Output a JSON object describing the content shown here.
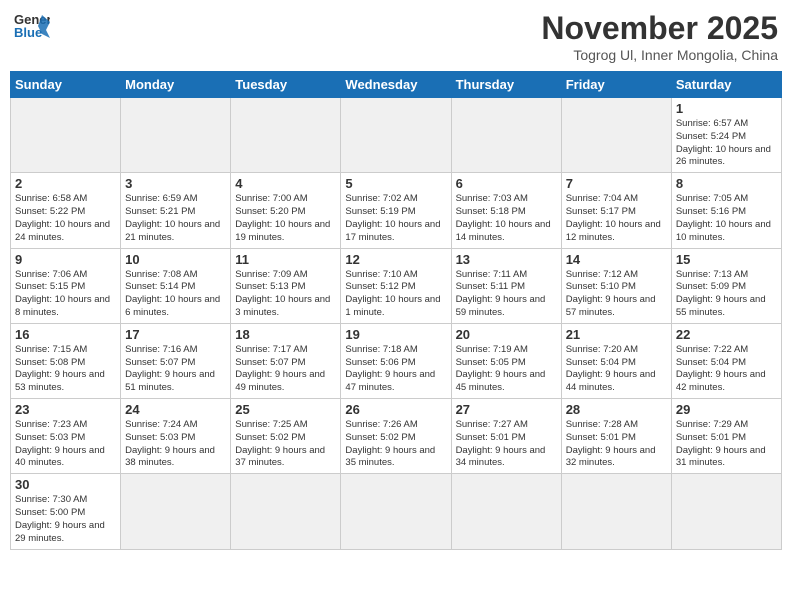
{
  "logo": {
    "text_general": "General",
    "text_blue": "Blue"
  },
  "title": "November 2025",
  "subtitle": "Togrog Ul, Inner Mongolia, China",
  "days_of_week": [
    "Sunday",
    "Monday",
    "Tuesday",
    "Wednesday",
    "Thursday",
    "Friday",
    "Saturday"
  ],
  "weeks": [
    [
      {
        "day": "",
        "info": "",
        "empty": true
      },
      {
        "day": "",
        "info": "",
        "empty": true
      },
      {
        "day": "",
        "info": "",
        "empty": true
      },
      {
        "day": "",
        "info": "",
        "empty": true
      },
      {
        "day": "",
        "info": "",
        "empty": true
      },
      {
        "day": "",
        "info": "",
        "empty": true
      },
      {
        "day": "1",
        "info": "Sunrise: 6:57 AM\nSunset: 5:24 PM\nDaylight: 10 hours and 26 minutes."
      }
    ],
    [
      {
        "day": "2",
        "info": "Sunrise: 6:58 AM\nSunset: 5:22 PM\nDaylight: 10 hours and 24 minutes."
      },
      {
        "day": "3",
        "info": "Sunrise: 6:59 AM\nSunset: 5:21 PM\nDaylight: 10 hours and 21 minutes."
      },
      {
        "day": "4",
        "info": "Sunrise: 7:00 AM\nSunset: 5:20 PM\nDaylight: 10 hours and 19 minutes."
      },
      {
        "day": "5",
        "info": "Sunrise: 7:02 AM\nSunset: 5:19 PM\nDaylight: 10 hours and 17 minutes."
      },
      {
        "day": "6",
        "info": "Sunrise: 7:03 AM\nSunset: 5:18 PM\nDaylight: 10 hours and 14 minutes."
      },
      {
        "day": "7",
        "info": "Sunrise: 7:04 AM\nSunset: 5:17 PM\nDaylight: 10 hours and 12 minutes."
      },
      {
        "day": "8",
        "info": "Sunrise: 7:05 AM\nSunset: 5:16 PM\nDaylight: 10 hours and 10 minutes."
      }
    ],
    [
      {
        "day": "9",
        "info": "Sunrise: 7:06 AM\nSunset: 5:15 PM\nDaylight: 10 hours and 8 minutes."
      },
      {
        "day": "10",
        "info": "Sunrise: 7:08 AM\nSunset: 5:14 PM\nDaylight: 10 hours and 6 minutes."
      },
      {
        "day": "11",
        "info": "Sunrise: 7:09 AM\nSunset: 5:13 PM\nDaylight: 10 hours and 3 minutes."
      },
      {
        "day": "12",
        "info": "Sunrise: 7:10 AM\nSunset: 5:12 PM\nDaylight: 10 hours and 1 minute."
      },
      {
        "day": "13",
        "info": "Sunrise: 7:11 AM\nSunset: 5:11 PM\nDaylight: 9 hours and 59 minutes."
      },
      {
        "day": "14",
        "info": "Sunrise: 7:12 AM\nSunset: 5:10 PM\nDaylight: 9 hours and 57 minutes."
      },
      {
        "day": "15",
        "info": "Sunrise: 7:13 AM\nSunset: 5:09 PM\nDaylight: 9 hours and 55 minutes."
      }
    ],
    [
      {
        "day": "16",
        "info": "Sunrise: 7:15 AM\nSunset: 5:08 PM\nDaylight: 9 hours and 53 minutes."
      },
      {
        "day": "17",
        "info": "Sunrise: 7:16 AM\nSunset: 5:07 PM\nDaylight: 9 hours and 51 minutes."
      },
      {
        "day": "18",
        "info": "Sunrise: 7:17 AM\nSunset: 5:07 PM\nDaylight: 9 hours and 49 minutes."
      },
      {
        "day": "19",
        "info": "Sunrise: 7:18 AM\nSunset: 5:06 PM\nDaylight: 9 hours and 47 minutes."
      },
      {
        "day": "20",
        "info": "Sunrise: 7:19 AM\nSunset: 5:05 PM\nDaylight: 9 hours and 45 minutes."
      },
      {
        "day": "21",
        "info": "Sunrise: 7:20 AM\nSunset: 5:04 PM\nDaylight: 9 hours and 44 minutes."
      },
      {
        "day": "22",
        "info": "Sunrise: 7:22 AM\nSunset: 5:04 PM\nDaylight: 9 hours and 42 minutes."
      }
    ],
    [
      {
        "day": "23",
        "info": "Sunrise: 7:23 AM\nSunset: 5:03 PM\nDaylight: 9 hours and 40 minutes."
      },
      {
        "day": "24",
        "info": "Sunrise: 7:24 AM\nSunset: 5:03 PM\nDaylight: 9 hours and 38 minutes."
      },
      {
        "day": "25",
        "info": "Sunrise: 7:25 AM\nSunset: 5:02 PM\nDaylight: 9 hours and 37 minutes."
      },
      {
        "day": "26",
        "info": "Sunrise: 7:26 AM\nSunset: 5:02 PM\nDaylight: 9 hours and 35 minutes."
      },
      {
        "day": "27",
        "info": "Sunrise: 7:27 AM\nSunset: 5:01 PM\nDaylight: 9 hours and 34 minutes."
      },
      {
        "day": "28",
        "info": "Sunrise: 7:28 AM\nSunset: 5:01 PM\nDaylight: 9 hours and 32 minutes."
      },
      {
        "day": "29",
        "info": "Sunrise: 7:29 AM\nSunset: 5:01 PM\nDaylight: 9 hours and 31 minutes."
      }
    ],
    [
      {
        "day": "30",
        "info": "Sunrise: 7:30 AM\nSunset: 5:00 PM\nDaylight: 9 hours and 29 minutes."
      },
      {
        "day": "",
        "info": "",
        "empty": true
      },
      {
        "day": "",
        "info": "",
        "empty": true
      },
      {
        "day": "",
        "info": "",
        "empty": true
      },
      {
        "day": "",
        "info": "",
        "empty": true
      },
      {
        "day": "",
        "info": "",
        "empty": true
      },
      {
        "day": "",
        "info": "",
        "empty": true
      }
    ]
  ]
}
